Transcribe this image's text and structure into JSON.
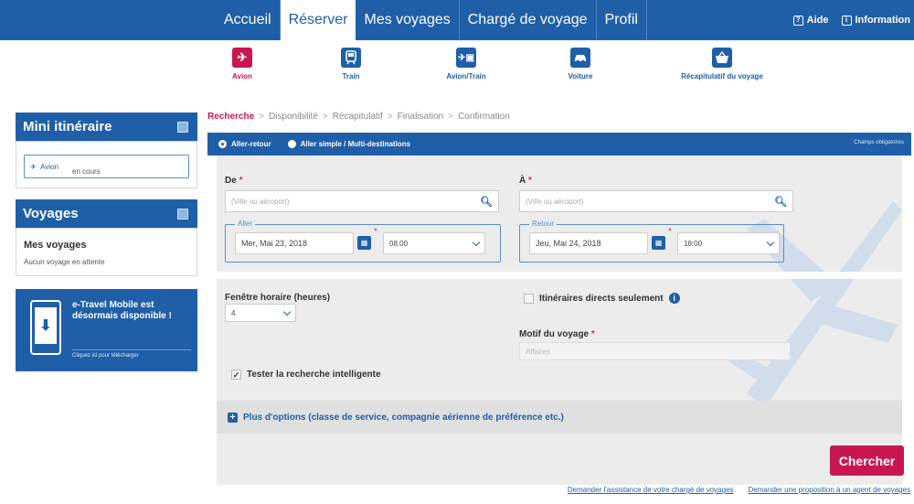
{
  "nav": {
    "tabs": [
      "Accueil",
      "Réserver",
      "Mes voyages",
      "Chargé de voyage",
      "Profil"
    ],
    "active_tab": "Réserver",
    "aide": "Aide",
    "information": "Information"
  },
  "products": [
    {
      "label": "Avion",
      "icon": "plane-icon",
      "active": true
    },
    {
      "label": "Train",
      "icon": "train-icon",
      "active": false
    },
    {
      "label": "Avion/Train",
      "icon": "plane-train-icon",
      "active": false
    },
    {
      "label": "Voiture",
      "icon": "car-icon",
      "active": false
    },
    {
      "label": "Récapitulatif du voyage",
      "icon": "basket-icon",
      "active": false
    }
  ],
  "sidebar": {
    "mini_title": "Mini itinéraire",
    "mini_plane": "Avion",
    "mini_status": "en cours",
    "voyages_title": "Voyages",
    "mes_voyages": "Mes voyages",
    "no_trip": "Aucun voyage en attente",
    "mobile_title": "e-Travel Mobile est désormais disponible !",
    "mobile_link": "Cliquez ici pour télécharger"
  },
  "breadcrumb": {
    "active": "Recherche",
    "steps": [
      "Disponibilité",
      "Récapitulatif",
      "Finalisation",
      "Confirmation"
    ]
  },
  "trip_type": {
    "round": "Aller-retour",
    "multi": "Aller simple / Multi-destinations",
    "required_note": "Champs obligatoires"
  },
  "form": {
    "from_label": "De",
    "to_label": "À",
    "from_placeholder": "(Ville ou aéroport)",
    "to_placeholder": "(Ville ou aéroport)",
    "aller_legend": "Aller",
    "retour_legend": "Retour",
    "aller_date": "Mer, Mai 23, 2018",
    "aller_time": "08:00",
    "retour_date": "Jeu, Mai 24, 2018",
    "retour_time": "18:00",
    "window_label": "Fenêtre horaire (heures)",
    "window_value": "4",
    "direct_label": "Itinéraires directs seulement",
    "motif_label": "Motif du voyage",
    "motif_value": "Affaires",
    "smart_label": "Tester la recherche intelligente",
    "more_options": "Plus d'options (classe de service, compagnie aérienne de préférence etc.)",
    "search_button": "Chercher"
  },
  "footer_links": [
    "Demander l'assistance de votre chargé de voyages",
    "Demander une proposition à un agent de voyages"
  ],
  "colors": {
    "brand_blue": "#1f5fa8",
    "accent_red": "#c8174f"
  }
}
